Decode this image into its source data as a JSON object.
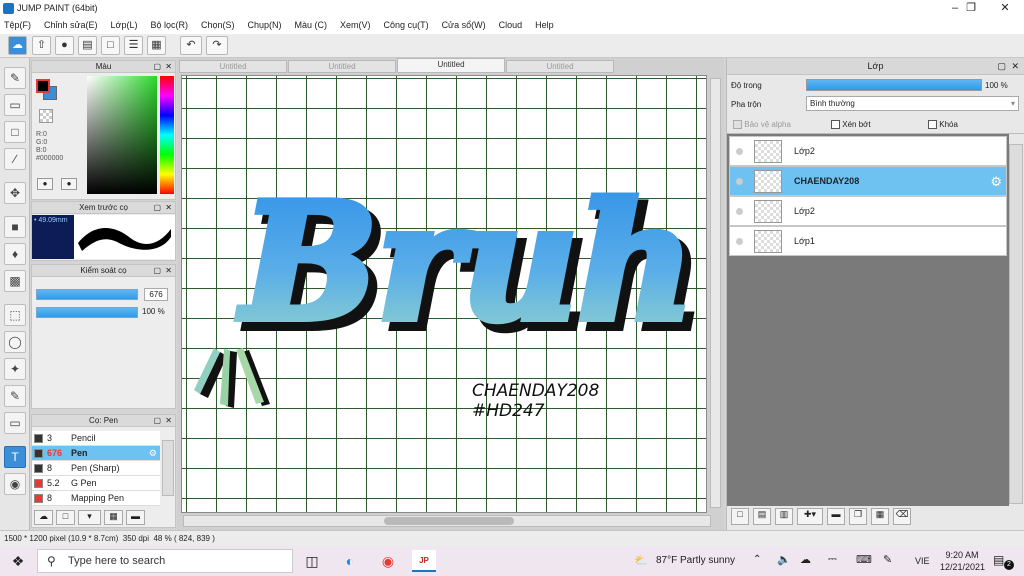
{
  "app": {
    "title": "JUMP PAINT (64bit)"
  },
  "menu": [
    "Tệp(F)",
    "Chỉnh sửa(E)",
    "Lớp(L)",
    "Bộ lọc(R)",
    "Chọn(S)",
    "Chụp(N)",
    "Màu (C)",
    "Xem(V)",
    "Công cụ(T)",
    "Cửa sổ(W)",
    "Cloud",
    "Help"
  ],
  "color_panel": {
    "title": "Màu",
    "r": "R:0",
    "g": "G:0",
    "b": "B:0",
    "hex": "#000000"
  },
  "preview_panel": {
    "title": "Xem trước cọ",
    "size": "49.09mm"
  },
  "brush_control": {
    "title": "Kiểm soát cọ",
    "size_value": "676",
    "opacity_value": "100 %",
    "size_fill": 0.98,
    "opacity_fill": 1.0
  },
  "brush_list": {
    "title": "Cọ: Pen",
    "items": [
      {
        "size": "3",
        "name": "Pencil",
        "color": "#333333"
      },
      {
        "size": "676",
        "name": "Pen",
        "color": "#333333",
        "selected": true
      },
      {
        "size": "8",
        "name": "Pen (Sharp)",
        "color": "#333333"
      },
      {
        "size": "5.2",
        "name": "G Pen",
        "color": "#e53935"
      },
      {
        "size": "8",
        "name": "Mapping Pen",
        "color": "#e53935"
      }
    ]
  },
  "tabs": [
    {
      "label": "Untitled",
      "active": false
    },
    {
      "label": "Untitled",
      "active": false
    },
    {
      "label": "Untitled",
      "active": true
    },
    {
      "label": "Untitled",
      "active": false
    }
  ],
  "canvas": {
    "big_text": "Bruh",
    "credit1": "CHAENDAY208",
    "credit2": "#HD247"
  },
  "layer_panel": {
    "title": "Lớp",
    "opacity_label": "Độ trong",
    "opacity_value": "100 %",
    "opacity_fill": 1.0,
    "blend_label": "Pha trộn",
    "blend_value": "Bình thường",
    "protect_alpha": "Bảo vệ alpha",
    "clip": "Xén bớt",
    "lock": "Khóa",
    "layers": [
      {
        "name": "Lớp2",
        "selected": false
      },
      {
        "name": "CHAENDAY208",
        "selected": true
      },
      {
        "name": "Lớp2",
        "selected": false
      },
      {
        "name": "Lớp1",
        "selected": false
      }
    ]
  },
  "status": {
    "dims": "1500 * 1200 pixel",
    "size_cm": "(10.9 * 8.7cm)",
    "dpi": "350 dpi",
    "zoom": "48 %",
    "coords": "( 824, 839 )"
  },
  "taskbar": {
    "search_placeholder": "Type here to search",
    "weather": "87°F  Partly sunny",
    "lang": "VIE",
    "time": "9:20 AM",
    "date": "12/21/2021",
    "notif": "2"
  },
  "colors": {
    "accent": "#3b8fd8",
    "selected_layer": "#6ec2f2",
    "grid": "#2e5a2e"
  }
}
